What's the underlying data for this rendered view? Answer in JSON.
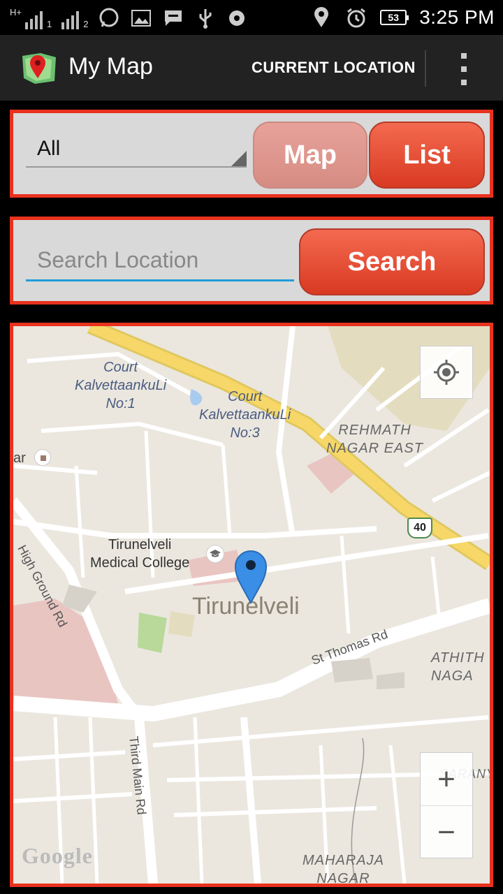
{
  "status_bar": {
    "network_type": "H+",
    "sim1": "1",
    "sim2": "2",
    "battery": "53",
    "time": "3:25 PM",
    "icons": [
      "whatsapp-icon",
      "image-icon",
      "message-icon",
      "usb-icon",
      "mute-icon",
      "location-icon",
      "alarm-icon"
    ]
  },
  "action_bar": {
    "title": "My Map",
    "current_location_label": "CURRENT LOCATION"
  },
  "filter": {
    "selected": "All",
    "map_button": "Map",
    "list_button": "List"
  },
  "search": {
    "placeholder": "Search Location",
    "button": "Search"
  },
  "map": {
    "labels": {
      "court1": "Court\nKalvettaankuLi\nNo:1",
      "court3": "Court\nKalvettaankuLi\nNo:3",
      "rehmath": "REHMATH\nNAGAR EAST",
      "ar": "ar",
      "college": "Tirunelveli\nMedical College",
      "city": "Tirunelveli",
      "highground": "High Ground Rd",
      "stthomas": "St Thomas Rd",
      "thirdmain": "Third Main Rd",
      "athith": "ATHITH\nNAGA",
      "saranya": "SARANYA",
      "maharaja": "MAHARAJA\nNAGAR",
      "highway": "40",
      "google": "Google"
    },
    "zoom_in": "+",
    "zoom_out": "−",
    "colors": {
      "highway": "#f6d768",
      "road": "#ffffff",
      "park": "#b8d99a",
      "hospital": "#e9c5c2",
      "land": "#ebe7df",
      "accent": "#e8321e"
    }
  }
}
